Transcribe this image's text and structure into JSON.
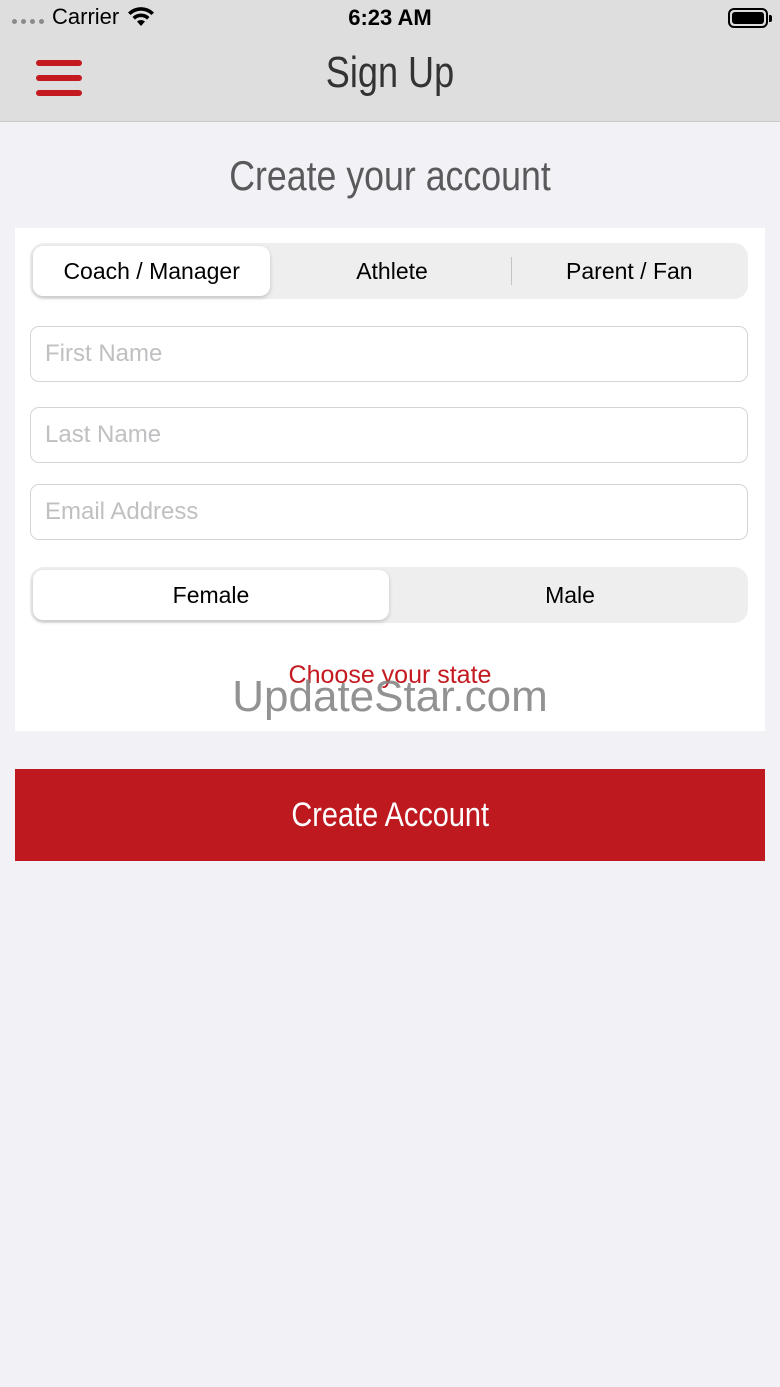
{
  "status_bar": {
    "carrier": "Carrier",
    "time": "6:23 AM"
  },
  "nav": {
    "title": "Sign Up",
    "menu_icon": "hamburger-icon"
  },
  "heading": "Create your account",
  "role_segment": {
    "options": [
      "Coach / Manager",
      "Athlete",
      "Parent / Fan"
    ],
    "selected": "Coach / Manager"
  },
  "fields": {
    "first_name": {
      "placeholder": "First Name",
      "value": ""
    },
    "last_name": {
      "placeholder": "Last Name",
      "value": ""
    },
    "email": {
      "placeholder": "Email Address",
      "value": ""
    }
  },
  "gender_segment": {
    "options": [
      "Female",
      "Male"
    ],
    "selected": "Female"
  },
  "state_link": "Choose your state",
  "watermark": "UpdateStar.com",
  "create_button": "Create Account",
  "colors": {
    "accent": "#be191f",
    "nav_bg": "#dedede",
    "page_bg": "#f1f1f6"
  }
}
